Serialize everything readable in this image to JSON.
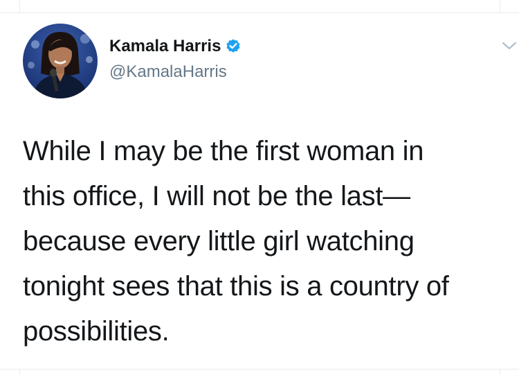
{
  "tweet": {
    "author_name": "Kamala Harris",
    "author_handle": "@KamalaHarris",
    "verified": true,
    "lines": [
      "While I may be the first woman in",
      "this office, I will not be the last—",
      "because every little girl watching",
      "tonight sees that this is a country of",
      "possibilities."
    ]
  },
  "colors": {
    "text": "#14171a",
    "secondary_text": "#657786",
    "verified_badge": "#1da1f2",
    "divider": "#e6ecf0"
  },
  "icons": {
    "verified": "verified-badge-icon",
    "menu": "chevron-down-icon"
  }
}
